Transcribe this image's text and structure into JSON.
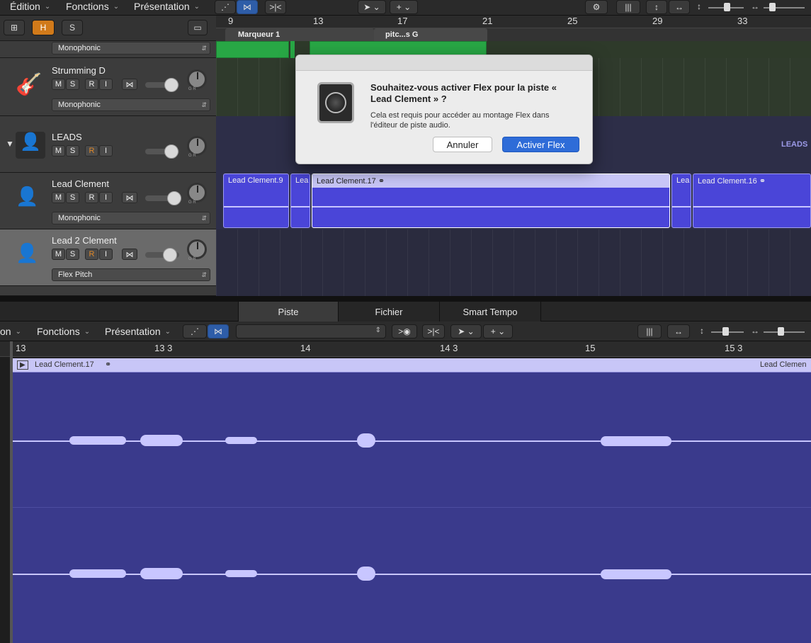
{
  "menu": {
    "edit": "Édition",
    "functions": "Fonctions",
    "view": "Présentation"
  },
  "track_header_buttons": {
    "h": "H",
    "s": "S"
  },
  "ruler": {
    "bars": [
      "9",
      "13",
      "17",
      "21",
      "25",
      "29",
      "33"
    ]
  },
  "markers": {
    "m1": "Marqueur 1",
    "m2": "pitc...s G"
  },
  "tracks": [
    {
      "name": "Strumming D",
      "mode": "Monophonic",
      "top_mode": "Monophonic"
    },
    {
      "name": "LEADS",
      "label_right": "LEADS"
    },
    {
      "name": "Lead Clement",
      "mode": "Monophonic"
    },
    {
      "name": "Lead 2 Clement",
      "mode": "Flex Pitch"
    }
  ],
  "btn": {
    "m": "M",
    "s": "S",
    "r": "R",
    "i": "I"
  },
  "dial_lbl": "G   R",
  "regions": [
    "Lead Clement.9",
    "Lea",
    "Lead Clement.17",
    "Lea",
    "Lead Clement.16"
  ],
  "dialog": {
    "title": "Souhaitez-vous activer Flex pour la piste « Lead Clement » ?",
    "body": "Cela est requis pour accéder au montage Flex dans l'éditeur de piste audio.",
    "cancel": "Annuler",
    "confirm": "Activer Flex"
  },
  "editor": {
    "tabs": [
      "Piste",
      "Fichier",
      "Smart Tempo"
    ],
    "menu": {
      "a": "on",
      "functions": "Fonctions",
      "view": "Présentation"
    },
    "ruler": [
      "13",
      "13 3",
      "14",
      "14 3",
      "15",
      "15 3"
    ],
    "region": "Lead Clement.17",
    "region_right": "Lead Clemen"
  },
  "colors": {
    "region": "#4a45d8",
    "editor_bg": "#3a3a8c",
    "green": "#28a745",
    "accent": "#2e6cd8"
  }
}
